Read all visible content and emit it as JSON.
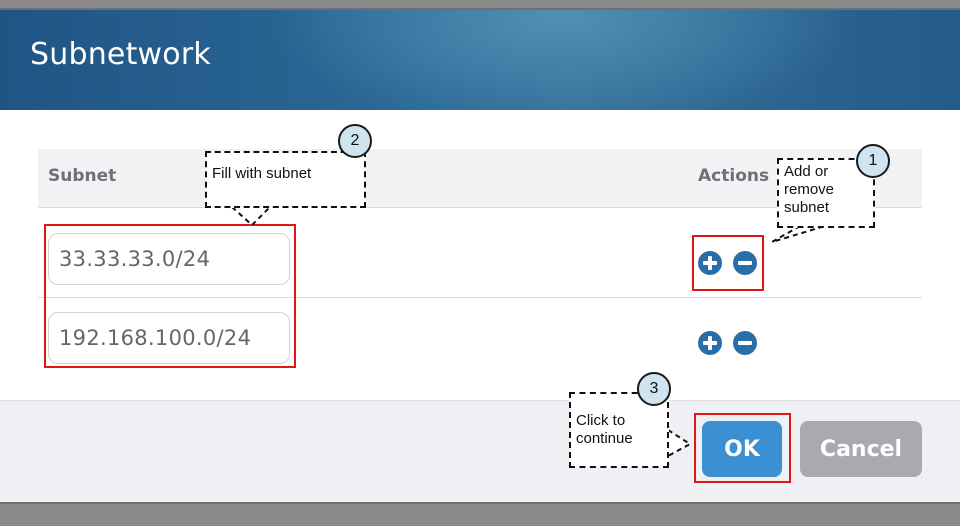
{
  "dialog": {
    "title": "Subnetwork"
  },
  "table": {
    "headers": {
      "subnet": "Subnet",
      "actions": "Actions"
    },
    "rows": [
      {
        "subnet": "33.33.33.0/24",
        "add_icon": "plus-circle-icon",
        "remove_icon": "minus-circle-icon"
      },
      {
        "subnet": "192.168.100.0/24",
        "add_icon": "plus-circle-icon",
        "remove_icon": "minus-circle-icon"
      }
    ]
  },
  "buttons": {
    "ok": "OK",
    "cancel": "Cancel"
  },
  "annotations": {
    "step1": {
      "number": "1",
      "text_line1": "Add or",
      "text_line2": "remove",
      "text_line3": "subnet"
    },
    "step2": {
      "number": "2",
      "text": "Fill with subnet"
    },
    "step3": {
      "number": "3",
      "text_line1": "Click to",
      "text_line2": "continue"
    }
  },
  "colors": {
    "header": "#2c6a97",
    "action_icon": "#2a6ea8",
    "ok_button": "#3b8fd3",
    "cancel_button": "#a8aaad",
    "highlight": "#e01616",
    "step_badge": "#cfe3f1"
  }
}
